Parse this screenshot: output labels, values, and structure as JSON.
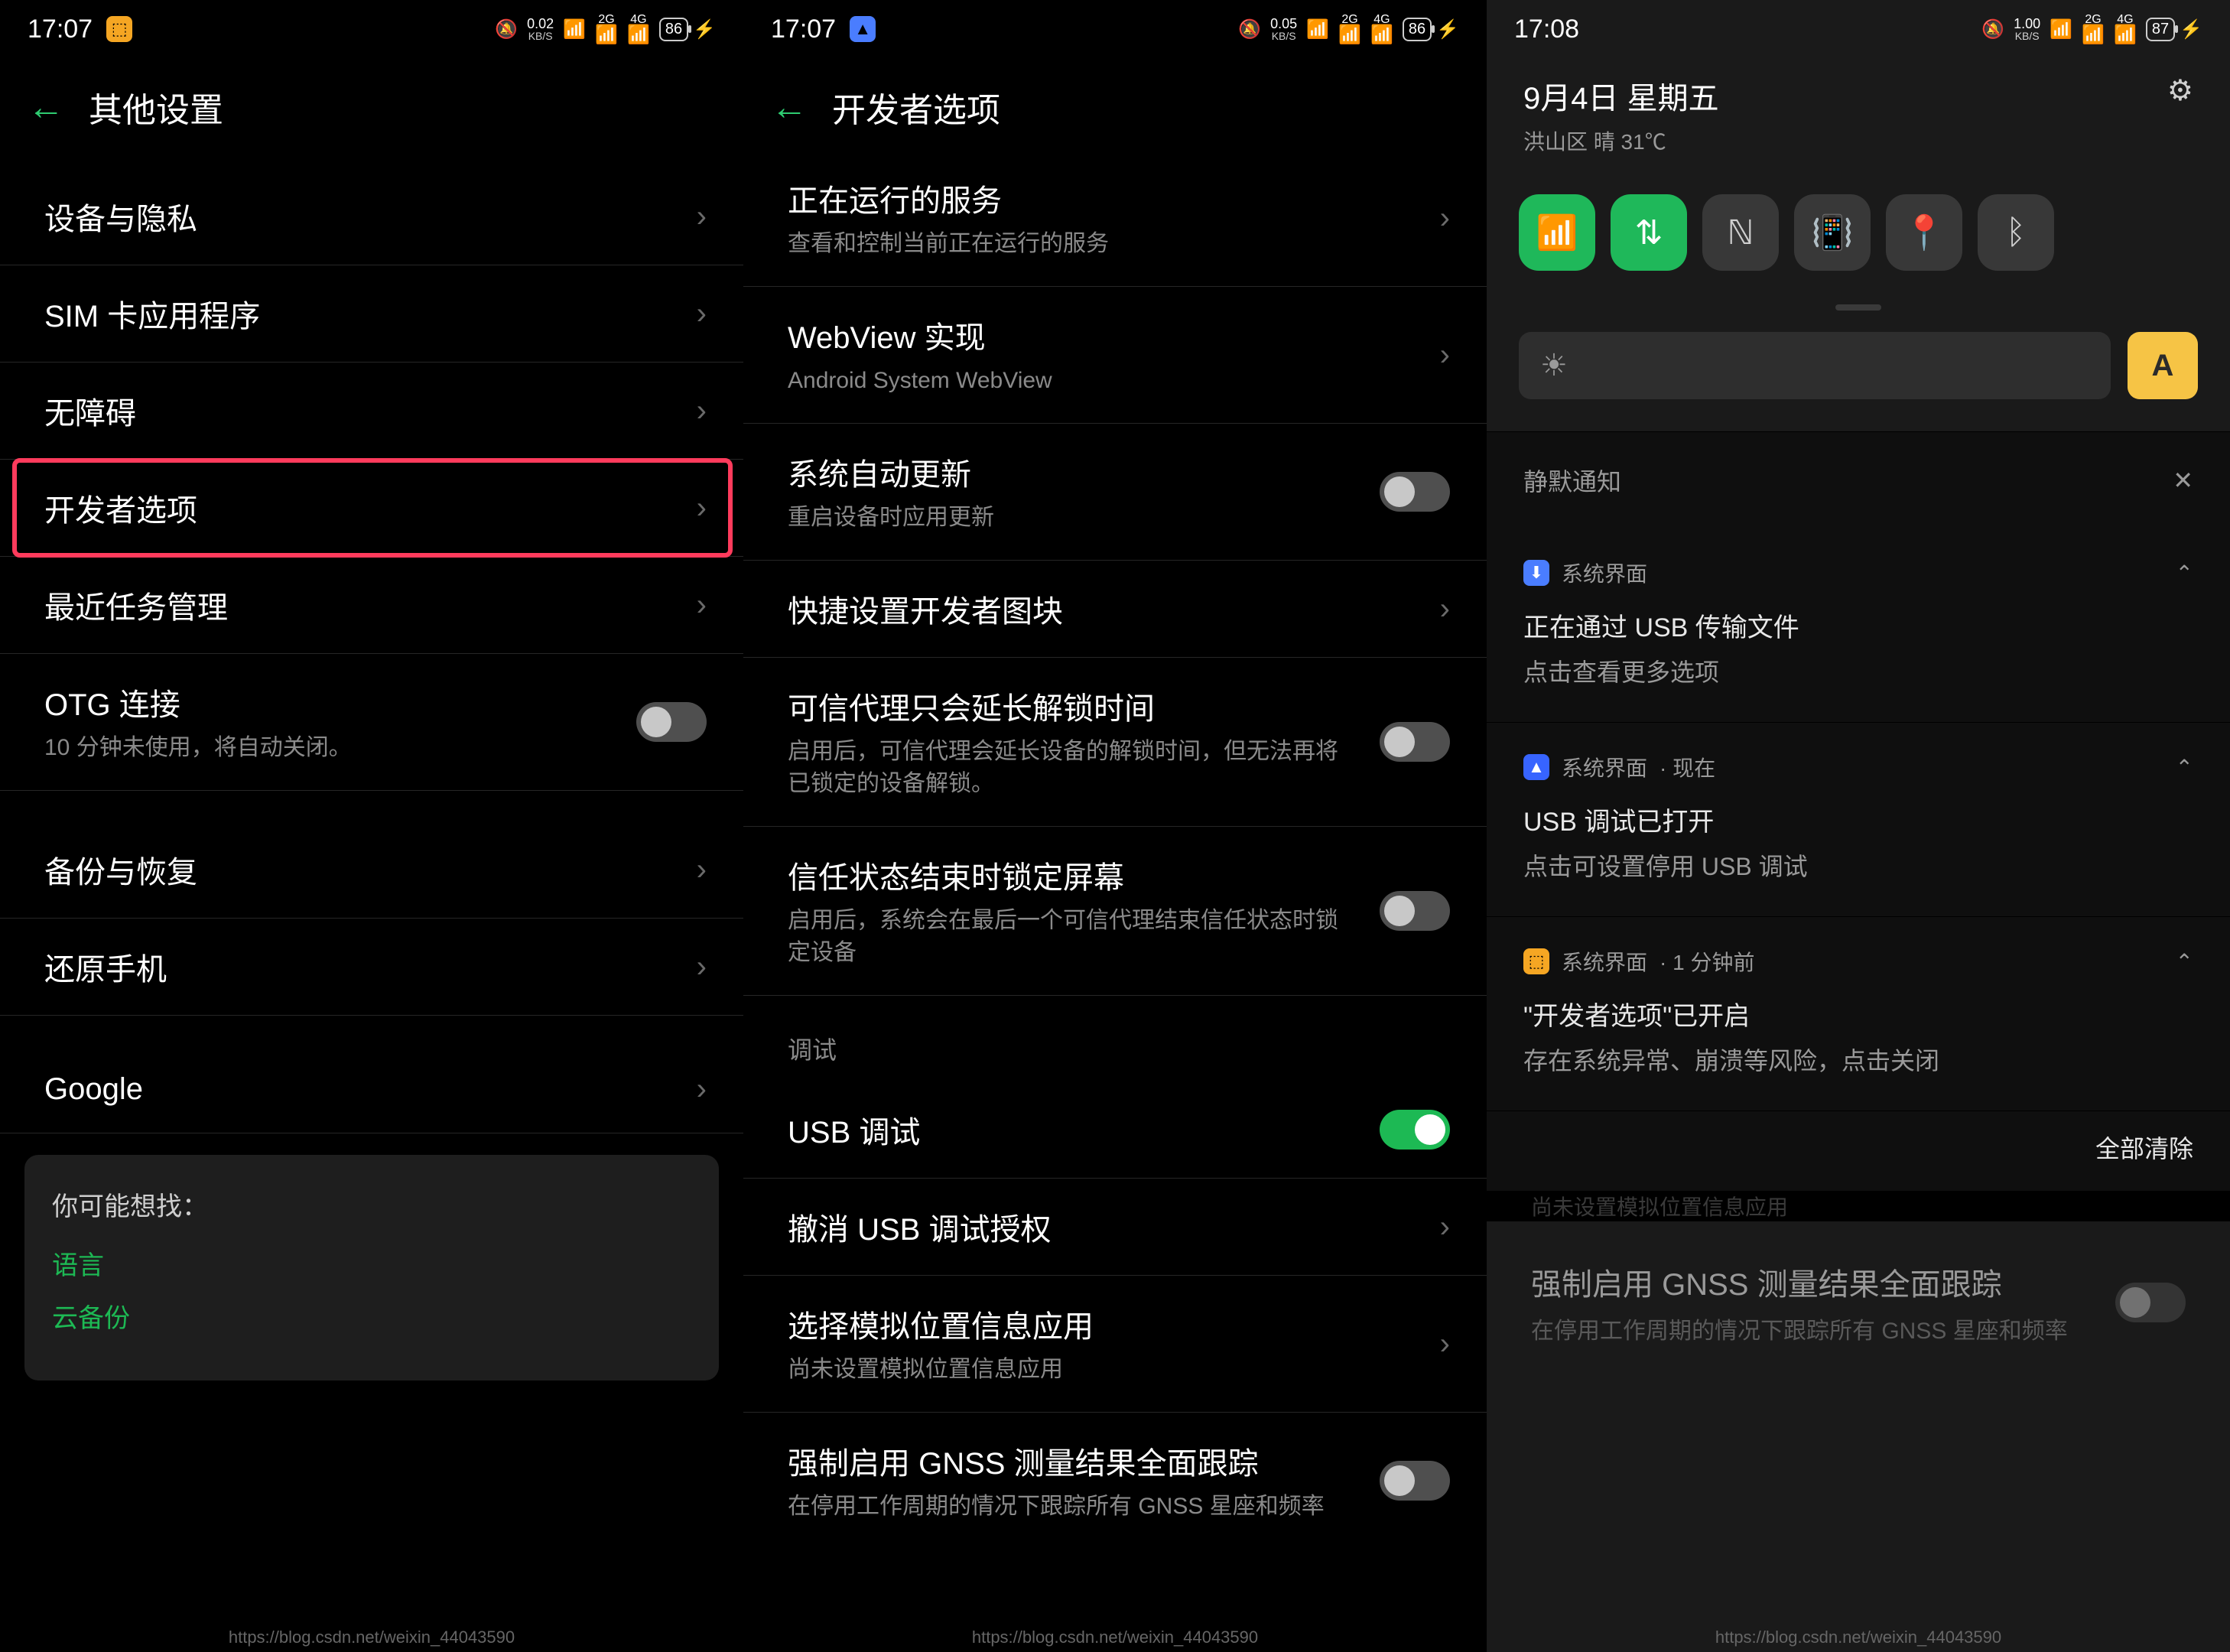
{
  "phone1": {
    "status": {
      "time": "17:07",
      "rate_val": "0.02",
      "rate_unit": "KB/S",
      "net1": "2G",
      "net2": "4G",
      "battery": "86"
    },
    "title": "其他设置",
    "rows": {
      "privacy": "设备与隐私",
      "sim": "SIM 卡应用程序",
      "accessibility": "无障碍",
      "developer": "开发者选项",
      "recents": "最近任务管理",
      "otg": "OTG 连接",
      "otg_sub": "10 分钟未使用，将自动关闭。",
      "backup": "备份与恢复",
      "restore": "还原手机",
      "google": "Google"
    },
    "card": {
      "hint": "你可能想找：",
      "link1": "语言",
      "link2": "云备份"
    },
    "watermark": "https://blog.csdn.net/weixin_44043590"
  },
  "phone2": {
    "status": {
      "time": "17:07",
      "rate_val": "0.05",
      "rate_unit": "KB/S",
      "net1": "2G",
      "net2": "4G",
      "battery": "86"
    },
    "title": "开发者选项",
    "rows": {
      "running": "正在运行的服务",
      "running_sub": "查看和控制当前正在运行的服务",
      "webview": "WebView 实现",
      "webview_sub": "Android System WebView",
      "sysupdate": "系统自动更新",
      "sysupdate_sub": "重启设备时应用更新",
      "quicktile": "快捷设置开发者图块",
      "trust_ext": "可信代理只会延长解锁时间",
      "trust_ext_sub": "启用后，可信代理会延长设备的解锁时间，但无法再将已锁定的设备解锁。",
      "trust_lock": "信任状态结束时锁定屏幕",
      "trust_lock_sub": "启用后，系统会在最后一个可信代理结束信任状态时锁定设备",
      "section_debug": "调试",
      "usb_debug": "USB 调试",
      "revoke": "撤消 USB 调试授权",
      "mock_loc": "选择模拟位置信息应用",
      "mock_loc_sub": "尚未设置模拟位置信息应用",
      "gnss": "强制启用 GNSS 测量结果全面跟踪",
      "gnss_sub": "在停用工作周期的情况下跟踪所有 GNSS 星座和频率"
    },
    "watermark": "https://blog.csdn.net/weixin_44043590"
  },
  "phone3": {
    "status": {
      "time": "17:08",
      "rate_val": "1.00",
      "rate_unit": "KB/S",
      "net1": "2G",
      "net2": "4G",
      "battery": "87"
    },
    "date": "9月4日  星期五",
    "weather": "洪山区 晴 31℃",
    "auto": "A",
    "silent_label": "静默通知",
    "notifs": [
      {
        "app": "系统界面",
        "meta": "",
        "title": "正在通过 USB 传输文件",
        "body": "点击查看更多选项",
        "icon": "blue"
      },
      {
        "app": "系统界面",
        "meta": " · 现在",
        "title": "USB 调试已打开",
        "body": "点击可设置停用 USB 调试",
        "icon": "blue2"
      },
      {
        "app": "系统界面",
        "meta": " · 1 分钟前",
        "title": "\"开发者选项\"已开启",
        "body": "存在系统异常、崩溃等风险，点击关闭",
        "icon": "orange"
      }
    ],
    "clear_all": "全部清除",
    "behind_sub": "尚未设置模拟位置信息应用",
    "gnss": "强制启用 GNSS 测量结果全面跟踪",
    "gnss_sub": "在停用工作周期的情况下跟踪所有 GNSS 星座和频率",
    "watermark": "https://blog.csdn.net/weixin_44043590"
  }
}
